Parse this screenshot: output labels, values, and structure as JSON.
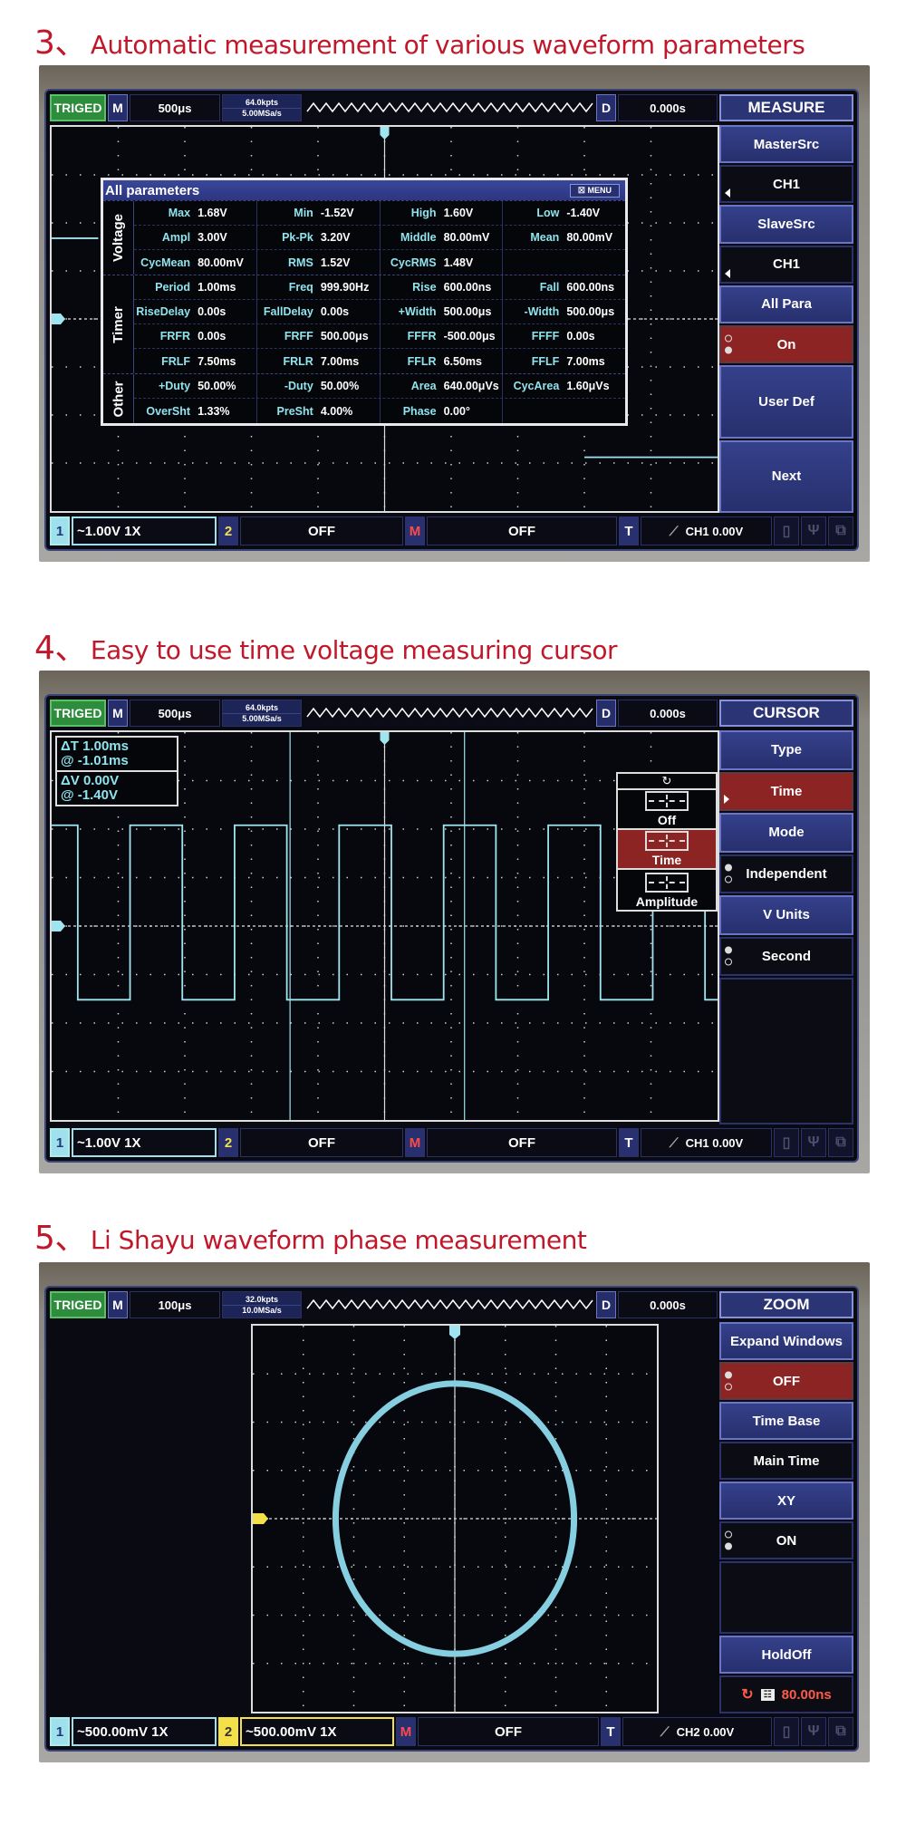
{
  "sections": [
    {
      "number": "3、",
      "title": "Automatic measurement of various waveform parameters",
      "topbar": {
        "status": "TRIGED",
        "mode": "M",
        "timebase": "500μs",
        "mem_depth": "64.0kpts",
        "sample_rate": "5.00MSa/s",
        "delay_label": "D",
        "delay": "0.000s",
        "menu_title": "MEASURE"
      },
      "side_menu": [
        {
          "label": "MasterSrc",
          "kind": "hdr"
        },
        {
          "label": "CH1",
          "kind": "val",
          "arrow": "left"
        },
        {
          "label": "SlaveSrc",
          "kind": "hdr"
        },
        {
          "label": "CH1",
          "kind": "val",
          "arrow": "left"
        },
        {
          "label": "All Para",
          "kind": "hdr"
        },
        {
          "label": "On",
          "kind": "sel",
          "radio": [
            false,
            true
          ]
        },
        {
          "label": "User Def",
          "kind": "hdr"
        },
        {
          "label": "Next",
          "kind": "hdr"
        }
      ],
      "params_panel": {
        "title": "All parameters",
        "menu_label": "MENU",
        "groups": [
          {
            "name": "Voltage",
            "rows": [
              [
                [
                  "Max",
                  "1.68V"
                ],
                [
                  "Min",
                  "-1.52V"
                ],
                [
                  "High",
                  "1.60V"
                ],
                [
                  "Low",
                  "-1.40V"
                ]
              ],
              [
                [
                  "Ampl",
                  "3.00V"
                ],
                [
                  "Pk-Pk",
                  "3.20V"
                ],
                [
                  "Middle",
                  "80.00mV"
                ],
                [
                  "Mean",
                  "80.00mV"
                ]
              ],
              [
                [
                  "CycMean",
                  "80.00mV"
                ],
                [
                  "RMS",
                  "1.52V"
                ],
                [
                  "CycRMS",
                  "1.48V"
                ],
                [
                  "",
                  ""
                ]
              ]
            ]
          },
          {
            "name": "Timer",
            "rows": [
              [
                [
                  "Period",
                  "1.00ms"
                ],
                [
                  "Freq",
                  "999.90Hz"
                ],
                [
                  "Rise",
                  "600.00ns"
                ],
                [
                  "Fall",
                  "600.00ns"
                ]
              ],
              [
                [
                  "RiseDelay",
                  "0.00s"
                ],
                [
                  "FallDelay",
                  "0.00s"
                ],
                [
                  "+Width",
                  "500.00μs"
                ],
                [
                  "-Width",
                  "500.00μs"
                ]
              ],
              [
                [
                  "FRFR",
                  "0.00s"
                ],
                [
                  "FRFF",
                  "500.00μs"
                ],
                [
                  "FFFR",
                  "-500.00μs"
                ],
                [
                  "FFFF",
                  "0.00s"
                ]
              ],
              [
                [
                  "FRLF",
                  "7.50ms"
                ],
                [
                  "FRLR",
                  "7.00ms"
                ],
                [
                  "FFLR",
                  "6.50ms"
                ],
                [
                  "FFLF",
                  "7.00ms"
                ]
              ]
            ]
          },
          {
            "name": "Other",
            "rows": [
              [
                [
                  "+Duty",
                  "50.00%"
                ],
                [
                  "-Duty",
                  "50.00%"
                ],
                [
                  "Area",
                  "640.00μVs"
                ],
                [
                  "CycArea",
                  "1.60μVs"
                ]
              ],
              [
                [
                  "OverSht",
                  "1.33%"
                ],
                [
                  "PreSht",
                  "4.00%"
                ],
                [
                  "Phase",
                  "0.00°"
                ],
                [
                  "",
                  ""
                ]
              ]
            ]
          }
        ]
      },
      "bottombar": {
        "ch1_num": "1",
        "ch1": "~1.00V 1X",
        "ch2_num": "2",
        "ch2": "OFF",
        "math_num": "M",
        "math": "OFF",
        "trig_num": "T",
        "trig_slope": "rising-edge-icon",
        "trig": "CH1 0.00V",
        "status_icons": [
          "usb-drive-icon",
          "usb-icon",
          "network-icon"
        ]
      }
    },
    {
      "number": "4、",
      "title": "Easy to use time voltage measuring cursor",
      "topbar": {
        "status": "TRIGED",
        "mode": "M",
        "timebase": "500μs",
        "mem_depth": "64.0kpts",
        "sample_rate": "5.00MSa/s",
        "delay_label": "D",
        "delay": "0.000s",
        "menu_title": "CURSOR"
      },
      "side_menu": [
        {
          "label": "Type",
          "kind": "hdr"
        },
        {
          "label": "Time",
          "kind": "sel",
          "arrow": "right"
        },
        {
          "label": "Mode",
          "kind": "hdr"
        },
        {
          "label": "Independent",
          "kind": "val",
          "radio": [
            true,
            false
          ]
        },
        {
          "label": "V Units",
          "kind": "hdr"
        },
        {
          "label": "Second",
          "kind": "val",
          "radio": [
            true,
            false
          ]
        },
        {
          "label": "",
          "kind": "blank"
        }
      ],
      "cursor_readout": {
        "delta_t": "ΔT 1.00ms",
        "at_t": "@  -1.01ms",
        "delta_v": "ΔV 0.00V",
        "at_v": "@  -1.40V"
      },
      "cursor_popup": {
        "rotate_icon": "↻",
        "options": [
          "Off",
          "Time",
          "Amplitude"
        ],
        "selected": "Time"
      },
      "bottombar": {
        "ch1_num": "1",
        "ch1": "~1.00V 1X",
        "ch2_num": "2",
        "ch2": "OFF",
        "math_num": "M",
        "math": "OFF",
        "trig_num": "T",
        "trig_slope": "rising-edge-icon",
        "trig": "CH1 0.00V",
        "status_icons": [
          "usb-drive-icon",
          "usb-icon",
          "network-icon"
        ]
      }
    },
    {
      "number": "5、",
      "title": "Li Shayu waveform phase measurement",
      "topbar": {
        "status": "TRIGED",
        "mode": "M",
        "timebase": "100μs",
        "mem_depth": "32.0kpts",
        "sample_rate": "10.0MSa/s",
        "delay_label": "D",
        "delay": "0.000s",
        "menu_title": "ZOOM"
      },
      "side_menu": [
        {
          "label": "Expand Windows",
          "kind": "hdr"
        },
        {
          "label": "OFF",
          "kind": "sel",
          "radio": [
            true,
            false
          ]
        },
        {
          "label": "Time Base",
          "kind": "hdr"
        },
        {
          "label": "Main Time",
          "kind": "val"
        },
        {
          "label": "XY",
          "kind": "hdr"
        },
        {
          "label": "ON",
          "kind": "val",
          "radio": [
            false,
            true
          ]
        },
        {
          "label": "",
          "kind": "blank-tall"
        },
        {
          "label": "HoldOff",
          "kind": "hdr"
        },
        {
          "label": "80.00ns",
          "kind": "holdoff"
        }
      ],
      "bottombar": {
        "ch1_num": "1",
        "ch1": "~500.00mV 1X",
        "ch2_num": "2",
        "ch2": "~500.00mV 1X",
        "math_num": "M",
        "math": "OFF",
        "trig_num": "T",
        "trig_slope": "rising-edge-icon",
        "trig": "CH2 0.00V",
        "status_icons": [
          "usb-drive-icon",
          "usb-icon",
          "network-icon"
        ]
      }
    }
  ],
  "colors": {
    "title_red": "#c0182a",
    "ch1_cyan": "#8fe4ee",
    "ch2_yellow": "#f4e14a",
    "menu_blue": "#2b3575",
    "selected_red": "#8c2424",
    "trig_green": "#2e8c3d"
  }
}
